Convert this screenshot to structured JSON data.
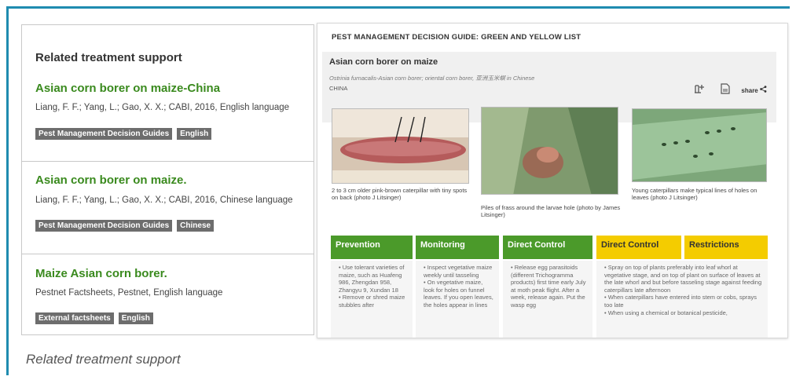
{
  "related": {
    "heading": "Related treatment support",
    "entries": [
      {
        "title": "Asian corn borer on maize-China",
        "meta": "Liang, F. F.; Yang, L.; Gao, X. X.; CABI, 2016, English language",
        "tags": [
          "Pest Management Decision Guides",
          "English"
        ]
      },
      {
        "title": "Asian corn borer on maize.",
        "meta": "Liang, F. F.; Yang, L.; Gao, X. X.; CABI, 2016, Chinese language",
        "tags": [
          "Pest Management Decision Guides",
          "Chinese"
        ]
      },
      {
        "title": "Maize Asian corn borer.",
        "meta": "Pestnet Factsheets, Pestnet, English language",
        "tags": [
          "External factsheets",
          "English"
        ]
      }
    ]
  },
  "caption": "Related treatment support",
  "guide": {
    "header": "PEST MANAGEMENT DECISION GUIDE: GREEN AND YELLOW LIST",
    "subtitle": "Asian corn borer on maize",
    "scientific": "Ostrinia furnacalis-Asian corn borer; oriental corn borer, 亚洲玉米螟 in Chinese",
    "country": "CHINA",
    "share_label": "share",
    "icons": [
      "add-to-list-icon",
      "document-icon",
      "share-icon"
    ],
    "photos": [
      {
        "caption": "2 to 3 cm older pink-brown caterpillar with tiny spots on back (photo J Litsinger)"
      },
      {
        "caption": "Piles of frass around the larvae hole (photo by James Litsinger)"
      },
      {
        "caption": "Young caterpillars make typical lines of holes on leaves (photo J Litsinger)"
      }
    ],
    "columns": [
      {
        "label": "Prevention",
        "color": "green",
        "items": [
          "Use tolerant varieties of maize, such as Huafeng 986, Zhengdan 958, Zhangyu 9, Xundan 18",
          "Remove or shred maize stubbles after"
        ]
      },
      {
        "label": "Monitoring",
        "color": "green",
        "items": [
          "Inspect vegetative maize weekly until tasseling",
          "On vegetative maize, look for holes on funnel leaves. If you open leaves, the holes appear in lines"
        ]
      },
      {
        "label": "Direct Control",
        "color": "green",
        "items": [
          "Release egg parasitoids (different Trichogramma products) first time early July at moth peak flight. After a week, release again. Put the wasp egg"
        ]
      },
      {
        "label": "Direct Control",
        "color": "yellow",
        "items": [
          "Spray on top of plants preferably into leaf whorl at vegetative stage, and on top of plant on surface of leaves at the late whorl and but before tasseling stage against feeding caterpillars late afternoon",
          "When caterpillars have entered into stem or cobs, sprays too late",
          "When using a chemical or botanical pesticide,"
        ]
      },
      {
        "label": "Restrictions",
        "color": "yellow",
        "items": []
      }
    ]
  },
  "colors": {
    "frame": "#1f8cb0",
    "link_green": "#3a8a1e",
    "tag_bg": "#6d6d6d",
    "green_list": "#4b9a2a",
    "yellow_list": "#f4cc00"
  }
}
